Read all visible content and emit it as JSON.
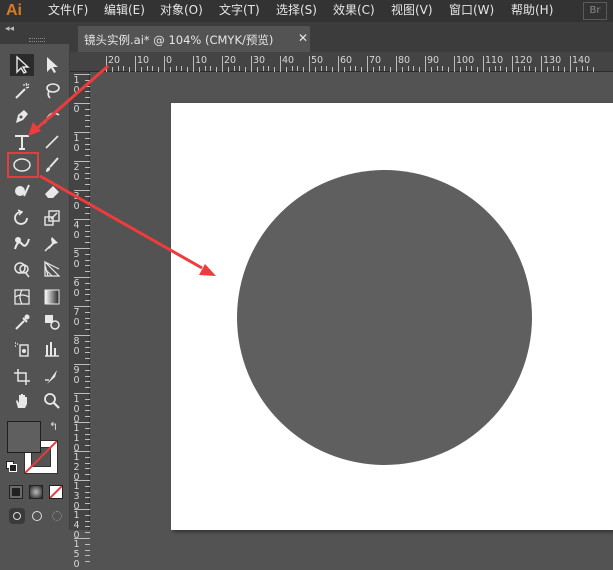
{
  "app": {
    "logo": "Ai",
    "bridge": "Br"
  },
  "menu": [
    "文件(F)",
    "编辑(E)",
    "对象(O)",
    "文字(T)",
    "选择(S)",
    "效果(C)",
    "视图(V)",
    "窗口(W)",
    "帮助(H)"
  ],
  "document_tab": {
    "title": "镜头实例.ai* @ 104% (CMYK/预览)",
    "close": "✕"
  },
  "ruler": {
    "horizontal": [
      "20",
      "10",
      "0",
      "10",
      "20",
      "30",
      "40",
      "50",
      "60",
      "70",
      "80",
      "90",
      "100",
      "110",
      "120",
      "130",
      "140"
    ],
    "vertical": [
      "1 0",
      "0",
      "1 0",
      "2 0",
      "3 0",
      "4 0",
      "5 0",
      "6 0",
      "7 0",
      "8 0",
      "9 0",
      "1 0 0",
      "1 1 0",
      "1 2 0",
      "1 3 0",
      "1 4 0",
      "1 5 0"
    ]
  },
  "tools": {
    "left": [
      "selection-icon",
      "pen-icon",
      "type-icon",
      "ellipse-icon",
      "shaper-icon",
      "rotate-icon",
      "warp-icon",
      "shape-builder-icon",
      "mesh-icon",
      "eyedropper-icon",
      "symbol-sprayer-icon",
      "artboard-icon",
      "hand-icon"
    ],
    "right": [
      "direct-selection-icon",
      "curvature-icon",
      "line-icon",
      "paintbrush-icon",
      "eraser-icon",
      "scale-icon",
      "puppet-warp-icon",
      "perspective-grid-icon",
      "gradient-icon",
      "blend-icon",
      "column-graph-icon",
      "slice-icon",
      "zoom-icon"
    ]
  },
  "colors": {
    "fill": "#5f5f5f",
    "stroke": "none",
    "highlight": "#e43d3d",
    "artboard": "#ffffff",
    "circle": "#5f5f5f"
  }
}
